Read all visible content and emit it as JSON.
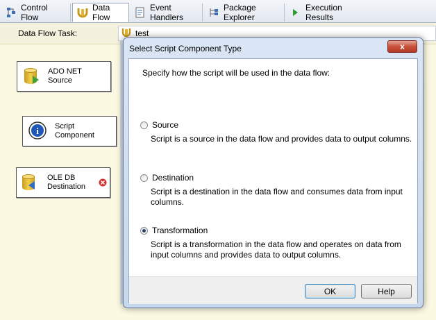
{
  "tabs": [
    {
      "label": "Control Flow",
      "icon": "control-flow-icon"
    },
    {
      "label": "Data Flow",
      "icon": "data-flow-icon",
      "active": true
    },
    {
      "label": "Event Handlers",
      "icon": "event-handlers-icon"
    },
    {
      "label": "Package Explorer",
      "icon": "package-explorer-icon"
    },
    {
      "label": "Execution Results",
      "icon": "execution-results-icon"
    }
  ],
  "task_selector": {
    "label": "Data Flow Task:",
    "value": "test"
  },
  "components": [
    {
      "line1": "ADO NET",
      "line2": "Source"
    },
    {
      "line1": "Script",
      "line2": "Component"
    },
    {
      "line1": "OLE DB",
      "line2": "Destination"
    }
  ],
  "dialog": {
    "title": "Select Script Component Type",
    "close_glyph": "x",
    "prompt": "Specify how the script will be used in the data flow:",
    "options": [
      {
        "label": "Source",
        "description": "Script is a source in the data flow and provides data to output columns.",
        "selected": false
      },
      {
        "label": "Destination",
        "description": "Script is a destination in the data flow and consumes data from input columns.",
        "selected": false
      },
      {
        "label": "Transformation",
        "description": "Script is a transformation in the data flow and operates on data from input columns and provides data to output columns.",
        "selected": true
      }
    ],
    "ok_label": "OK",
    "help_label": "Help"
  },
  "colors": {
    "canvas": "#fcf9e3",
    "error": "#d0342c",
    "accent": "#3c7fb1"
  }
}
